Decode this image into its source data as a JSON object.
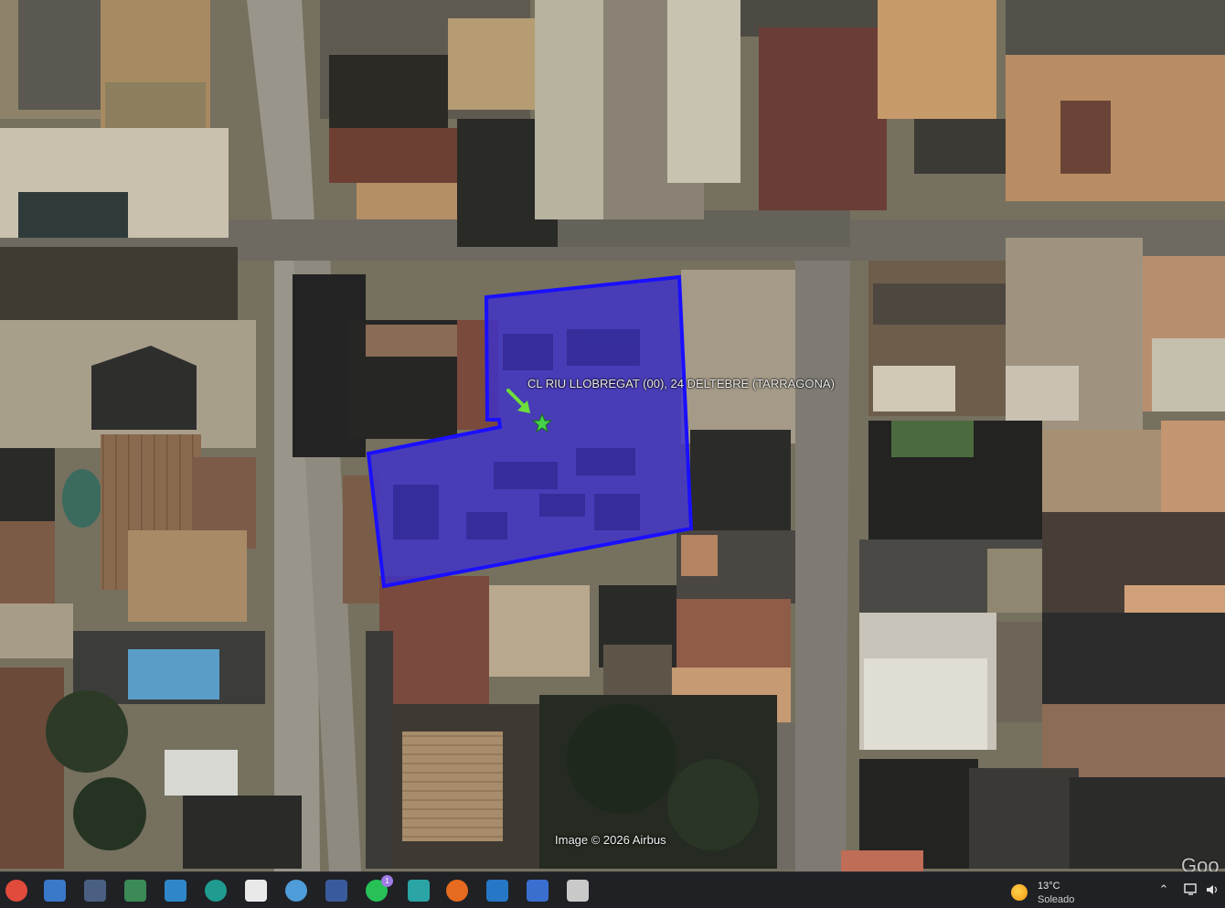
{
  "map": {
    "placemark_label": "CL RIU LLOBREGAT (00), 24  DELTEBRE (TARRAGONA)",
    "credit": "Image © 2026 Airbus",
    "corner_logo": "Goo",
    "parcel_fill": "#3b2fd0",
    "parcel_stroke": "#1a0fff",
    "arrow_color": "#6ddf3a",
    "star_color": "#44d24a"
  },
  "taskbar": {
    "apps": [
      {
        "name": "chrome-icon",
        "color": "#e14b3c"
      },
      {
        "name": "whiteboard-icon",
        "color": "#3a78c9"
      },
      {
        "name": "photos-icon",
        "color": "#4b5f82"
      },
      {
        "name": "store-lock-icon",
        "color": "#3b8a57"
      },
      {
        "name": "gallery-icon",
        "color": "#2f87c9"
      },
      {
        "name": "edge-icon",
        "color": "#1f9c8f"
      },
      {
        "name": "document-icon",
        "color": "#e9e9e9"
      },
      {
        "name": "globe-icon",
        "color": "#4e9cd9"
      },
      {
        "name": "save-icon",
        "color": "#3a5b9b"
      },
      {
        "name": "whatsapp-icon",
        "color": "#27c158"
      },
      {
        "name": "mirror-icon",
        "color": "#2aa4a4"
      },
      {
        "name": "firefox-icon",
        "color": "#e66a1f"
      },
      {
        "name": "s-app-icon",
        "color": "#2777c7"
      },
      {
        "name": "arrow-app-icon",
        "color": "#3a6fd0"
      },
      {
        "name": "window-app-icon",
        "color": "#c9c9c9"
      }
    ],
    "whatsapp_badge": "1",
    "weather": {
      "temperature": "13°C",
      "condition": "Soleado"
    }
  }
}
